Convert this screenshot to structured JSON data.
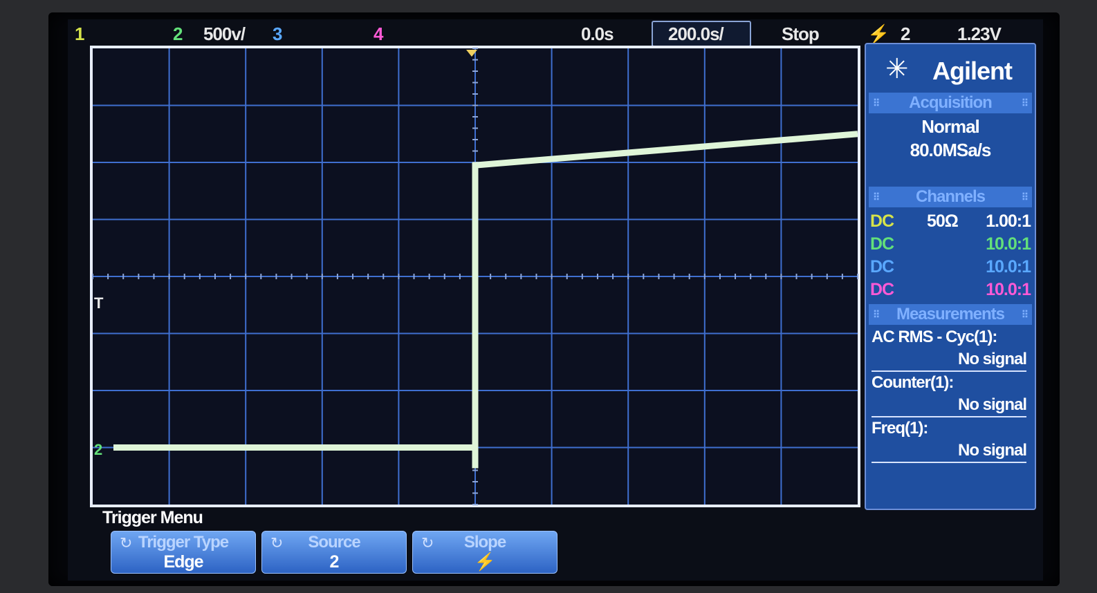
{
  "status_bar": {
    "ch1_label": "1",
    "ch2_label": "2",
    "ch2_scale": "500v/",
    "ch3_label": "3",
    "ch4_label": "4",
    "time_position": "0.0s",
    "time_scale": "200.0s/",
    "run_state": "Stop",
    "trigger_icon": "edge-trigger-icon",
    "trigger_channel": "2",
    "trigger_level": "1.23V"
  },
  "display": {
    "trigger_marker": "T",
    "ch2_ground_marker": "2",
    "waveform": {
      "low_level_div": -3.0,
      "high_level_start_div": 1.95,
      "high_level_end_div": 2.5,
      "edge_time_div": 0.0
    }
  },
  "panel": {
    "brand": "Agilent",
    "acquisition_title": "Acquisition",
    "acquisition_mode": "Normal",
    "sample_rate": "80.0MSa/s",
    "channels_title": "Channels",
    "channels": [
      {
        "coupling": "DC",
        "impedance": "50Ω",
        "probe": "1.00:1",
        "color": "#d6e34a"
      },
      {
        "coupling": "DC",
        "impedance": "",
        "probe": "10.0:1",
        "color": "#63e07a"
      },
      {
        "coupling": "DC",
        "impedance": "",
        "probe": "10.0:1",
        "color": "#5aa8ff"
      },
      {
        "coupling": "DC",
        "impedance": "",
        "probe": "10.0:1",
        "color": "#ff5ad6"
      }
    ],
    "measurements_title": "Measurements",
    "measurements": [
      {
        "label": "AC RMS - Cyc(1):",
        "value": "No signal"
      },
      {
        "label": "Counter(1):",
        "value": "No signal"
      },
      {
        "label": "Freq(1):",
        "value": "No signal"
      }
    ]
  },
  "menu": {
    "title": "Trigger Menu",
    "softkeys": [
      {
        "label": "Trigger Type",
        "value": "Edge"
      },
      {
        "label": "Source",
        "value": "2"
      },
      {
        "label": "Slope",
        "value": "⚡"
      }
    ]
  },
  "colors": {
    "ch1": "#d6e34a",
    "ch2": "#63e07a",
    "ch3": "#5aa8ff",
    "ch4": "#ff5ad6",
    "trace": "#dff5d8",
    "grid": "#3f6fd0"
  }
}
